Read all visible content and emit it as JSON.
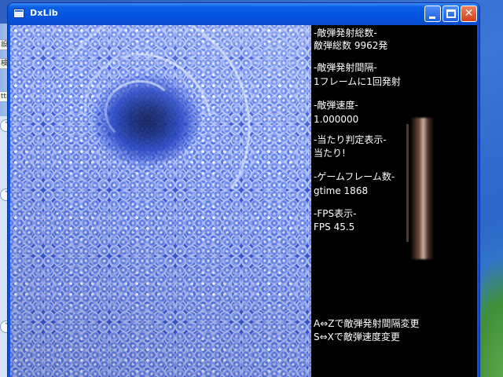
{
  "window": {
    "title": "DxLib"
  },
  "left_pane": {
    "stubs": [
      "設定",
      "検索",
      "ttin"
    ]
  },
  "info": {
    "lines": [
      "-敵弾発射総数-",
      "敵弾総数 9962発",
      "-敵弾発射間隔-",
      "1フレームに1回発射",
      "-敵弾速度-",
      "1.000000",
      "-当たり判定表示-",
      "当たり!",
      "-ゲームフレーム数-",
      "gtime 1868",
      "-FPS表示-",
      "FPS 45.5",
      "A⇔Zで敵弾発射間隔変更",
      "S⇔Xで敵弾速度変更"
    ]
  },
  "colors": {
    "titlebar": "#0353e0",
    "close_button": "#d3401c",
    "field": "#3a57d8",
    "panel_bg": "#000000",
    "panel_text": "#ffffff"
  },
  "icons": {
    "app": "app-icon",
    "minimize": "minimize-icon",
    "maximize": "maximize-icon",
    "close": "close-icon",
    "collapse": "chevron-up-icon"
  }
}
